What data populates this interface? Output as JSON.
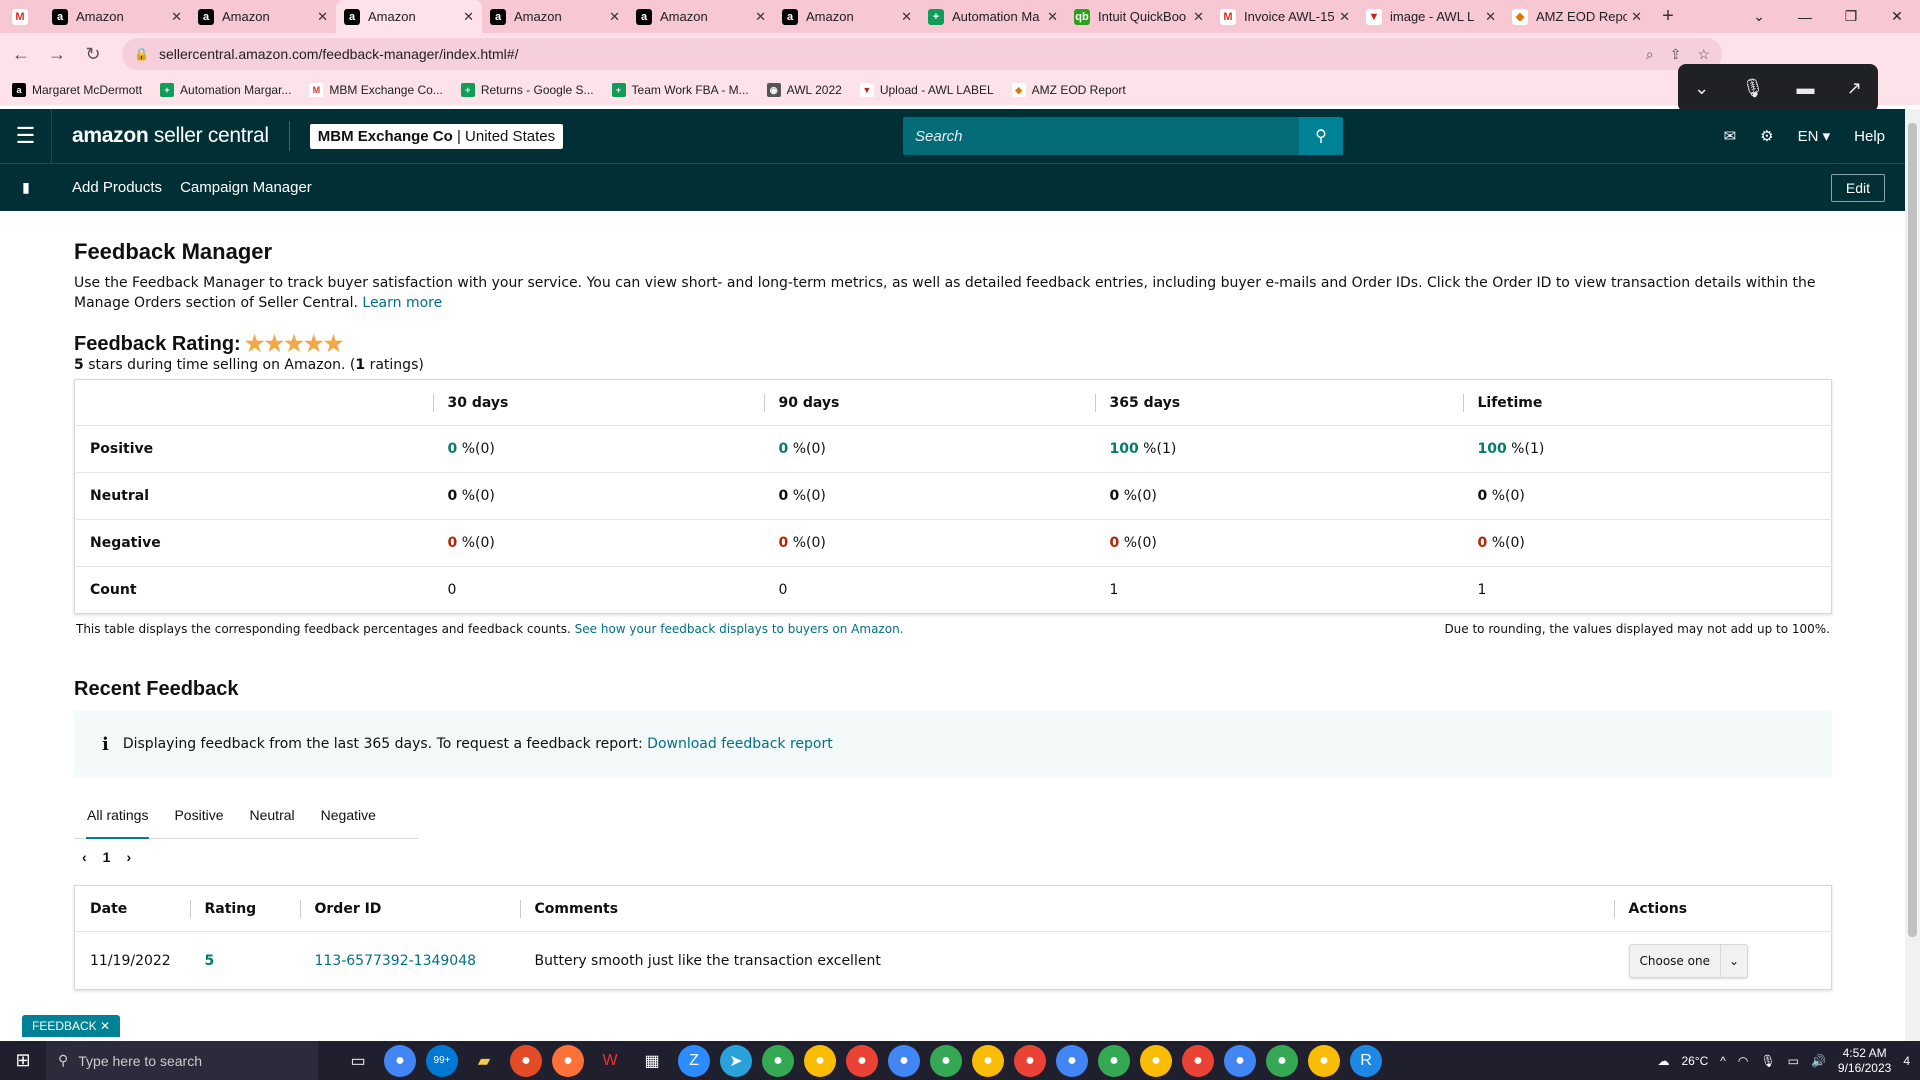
{
  "browser": {
    "tabs": [
      {
        "title": "Amazon",
        "icon": "amazon-icon"
      },
      {
        "title": "Amazon",
        "icon": "amazon-icon"
      },
      {
        "title": "Amazon",
        "icon": "amazon-icon",
        "active": true
      },
      {
        "title": "Amazon",
        "icon": "amazon-icon"
      },
      {
        "title": "Amazon",
        "icon": "amazon-icon"
      },
      {
        "title": "Amazon",
        "icon": "amazon-icon"
      },
      {
        "title": "Automation Ma",
        "icon": "sheets-icon"
      },
      {
        "title": "Intuit QuickBoo",
        "icon": "quickbooks-icon"
      },
      {
        "title": "Invoice AWL-15",
        "icon": "gmail-icon"
      },
      {
        "title": "image - AWL L",
        "icon": "upload-icon"
      },
      {
        "title": "AMZ EOD Repo",
        "icon": "report-icon"
      }
    ],
    "url": "sellercentral.amazon.com/feedback-manager/index.html#/",
    "bookmarks": [
      {
        "label": "Margaret McDermott",
        "icon": "amazon-icon"
      },
      {
        "label": "Automation Margar...",
        "icon": "sheets-icon"
      },
      {
        "label": "MBM Exchange Co...",
        "icon": "gmail-icon"
      },
      {
        "label": "Returns - Google S...",
        "icon": "sheets-icon"
      },
      {
        "label": "Team Work FBA - M...",
        "icon": "sheets-icon"
      },
      {
        "label": "AWL 2022",
        "icon": "globe-icon"
      },
      {
        "label": "Upload - AWL LABEL",
        "icon": "upload-icon"
      },
      {
        "label": "AMZ EOD Report",
        "icon": "report-icon"
      }
    ]
  },
  "header": {
    "logo_a": "amazon",
    "logo_b": " seller central",
    "account_name": "MBM Exchange Co",
    "account_region": "United States",
    "search_placeholder": "Search",
    "language": "EN",
    "help": "Help"
  },
  "subnav": {
    "links": [
      "Add Products",
      "Campaign Manager"
    ],
    "edit": "Edit"
  },
  "page": {
    "title": "Feedback Manager",
    "intro": "Use the Feedback Manager to track buyer satisfaction with your service. You can view short- and long-term metrics, as well as detailed feedback entries, including buyer e-mails and Order IDs. Click the Order ID to view transaction details within the Manage Orders section of Seller Central.",
    "learn_more": "Learn more",
    "rating_label": "Feedback Rating:",
    "stars": 5,
    "rating_sub_stars": "5",
    "rating_sub_text": " stars during time selling on Amazon. (",
    "rating_sub_count": "1",
    "rating_sub_end": " ratings)"
  },
  "summary_table": {
    "columns": [
      "30 days",
      "90 days",
      "365 days",
      "Lifetime"
    ],
    "rows": [
      {
        "label": "Positive",
        "cells": [
          {
            "num": "0",
            "rest": " %(0)"
          },
          {
            "num": "0",
            "rest": " %(0)"
          },
          {
            "num": "100",
            "rest": " %(1)"
          },
          {
            "num": "100",
            "rest": " %(1)"
          }
        ]
      },
      {
        "label": "Neutral",
        "cells": [
          {
            "num": "0",
            "rest": " %(0)"
          },
          {
            "num": "0",
            "rest": " %(0)"
          },
          {
            "num": "0",
            "rest": " %(0)"
          },
          {
            "num": "0",
            "rest": " %(0)"
          }
        ]
      },
      {
        "label": "Negative",
        "cells": [
          {
            "num": "0",
            "rest": " %(0)"
          },
          {
            "num": "0",
            "rest": " %(0)"
          },
          {
            "num": "0",
            "rest": " %(0)"
          },
          {
            "num": "0",
            "rest": " %(0)"
          }
        ]
      },
      {
        "label": "Count",
        "cells": [
          {
            "num": "0"
          },
          {
            "num": "0"
          },
          {
            "num": "1"
          },
          {
            "num": "1"
          }
        ]
      }
    ],
    "foot_left": "This table displays the corresponding feedback percentages and feedback counts.",
    "foot_link": "See how your feedback displays to buyers on Amazon.",
    "foot_right": "Due to rounding, the values displayed may not add up to 100%."
  },
  "recent": {
    "title": "Recent Feedback",
    "info_text": "Displaying feedback from the last 365 days. To request a feedback report:",
    "info_link": "Download feedback report",
    "tabs": [
      "All ratings",
      "Positive",
      "Neutral",
      "Negative"
    ],
    "page": "1",
    "columns": [
      "Date",
      "Rating",
      "Order ID",
      "Comments",
      "Actions"
    ],
    "rows": [
      {
        "date": "11/19/2022",
        "rating": "5",
        "order_id": "113-6577392-1349048",
        "comment": "Buttery smooth just like the transaction excellent",
        "action": "Choose one"
      }
    ]
  },
  "feedback_tag": "FEEDBACK",
  "taskbar": {
    "search_placeholder": "Type here to search",
    "weather": "26°C",
    "time": "4:52 AM",
    "date": "9/16/2023",
    "notif_count": "4",
    "mail_badge": "99+"
  },
  "colors": {
    "header_bg": "#002f36",
    "link": "#007185",
    "positive": "#067d62",
    "negative": "#b12704",
    "star": "#f3a847"
  }
}
